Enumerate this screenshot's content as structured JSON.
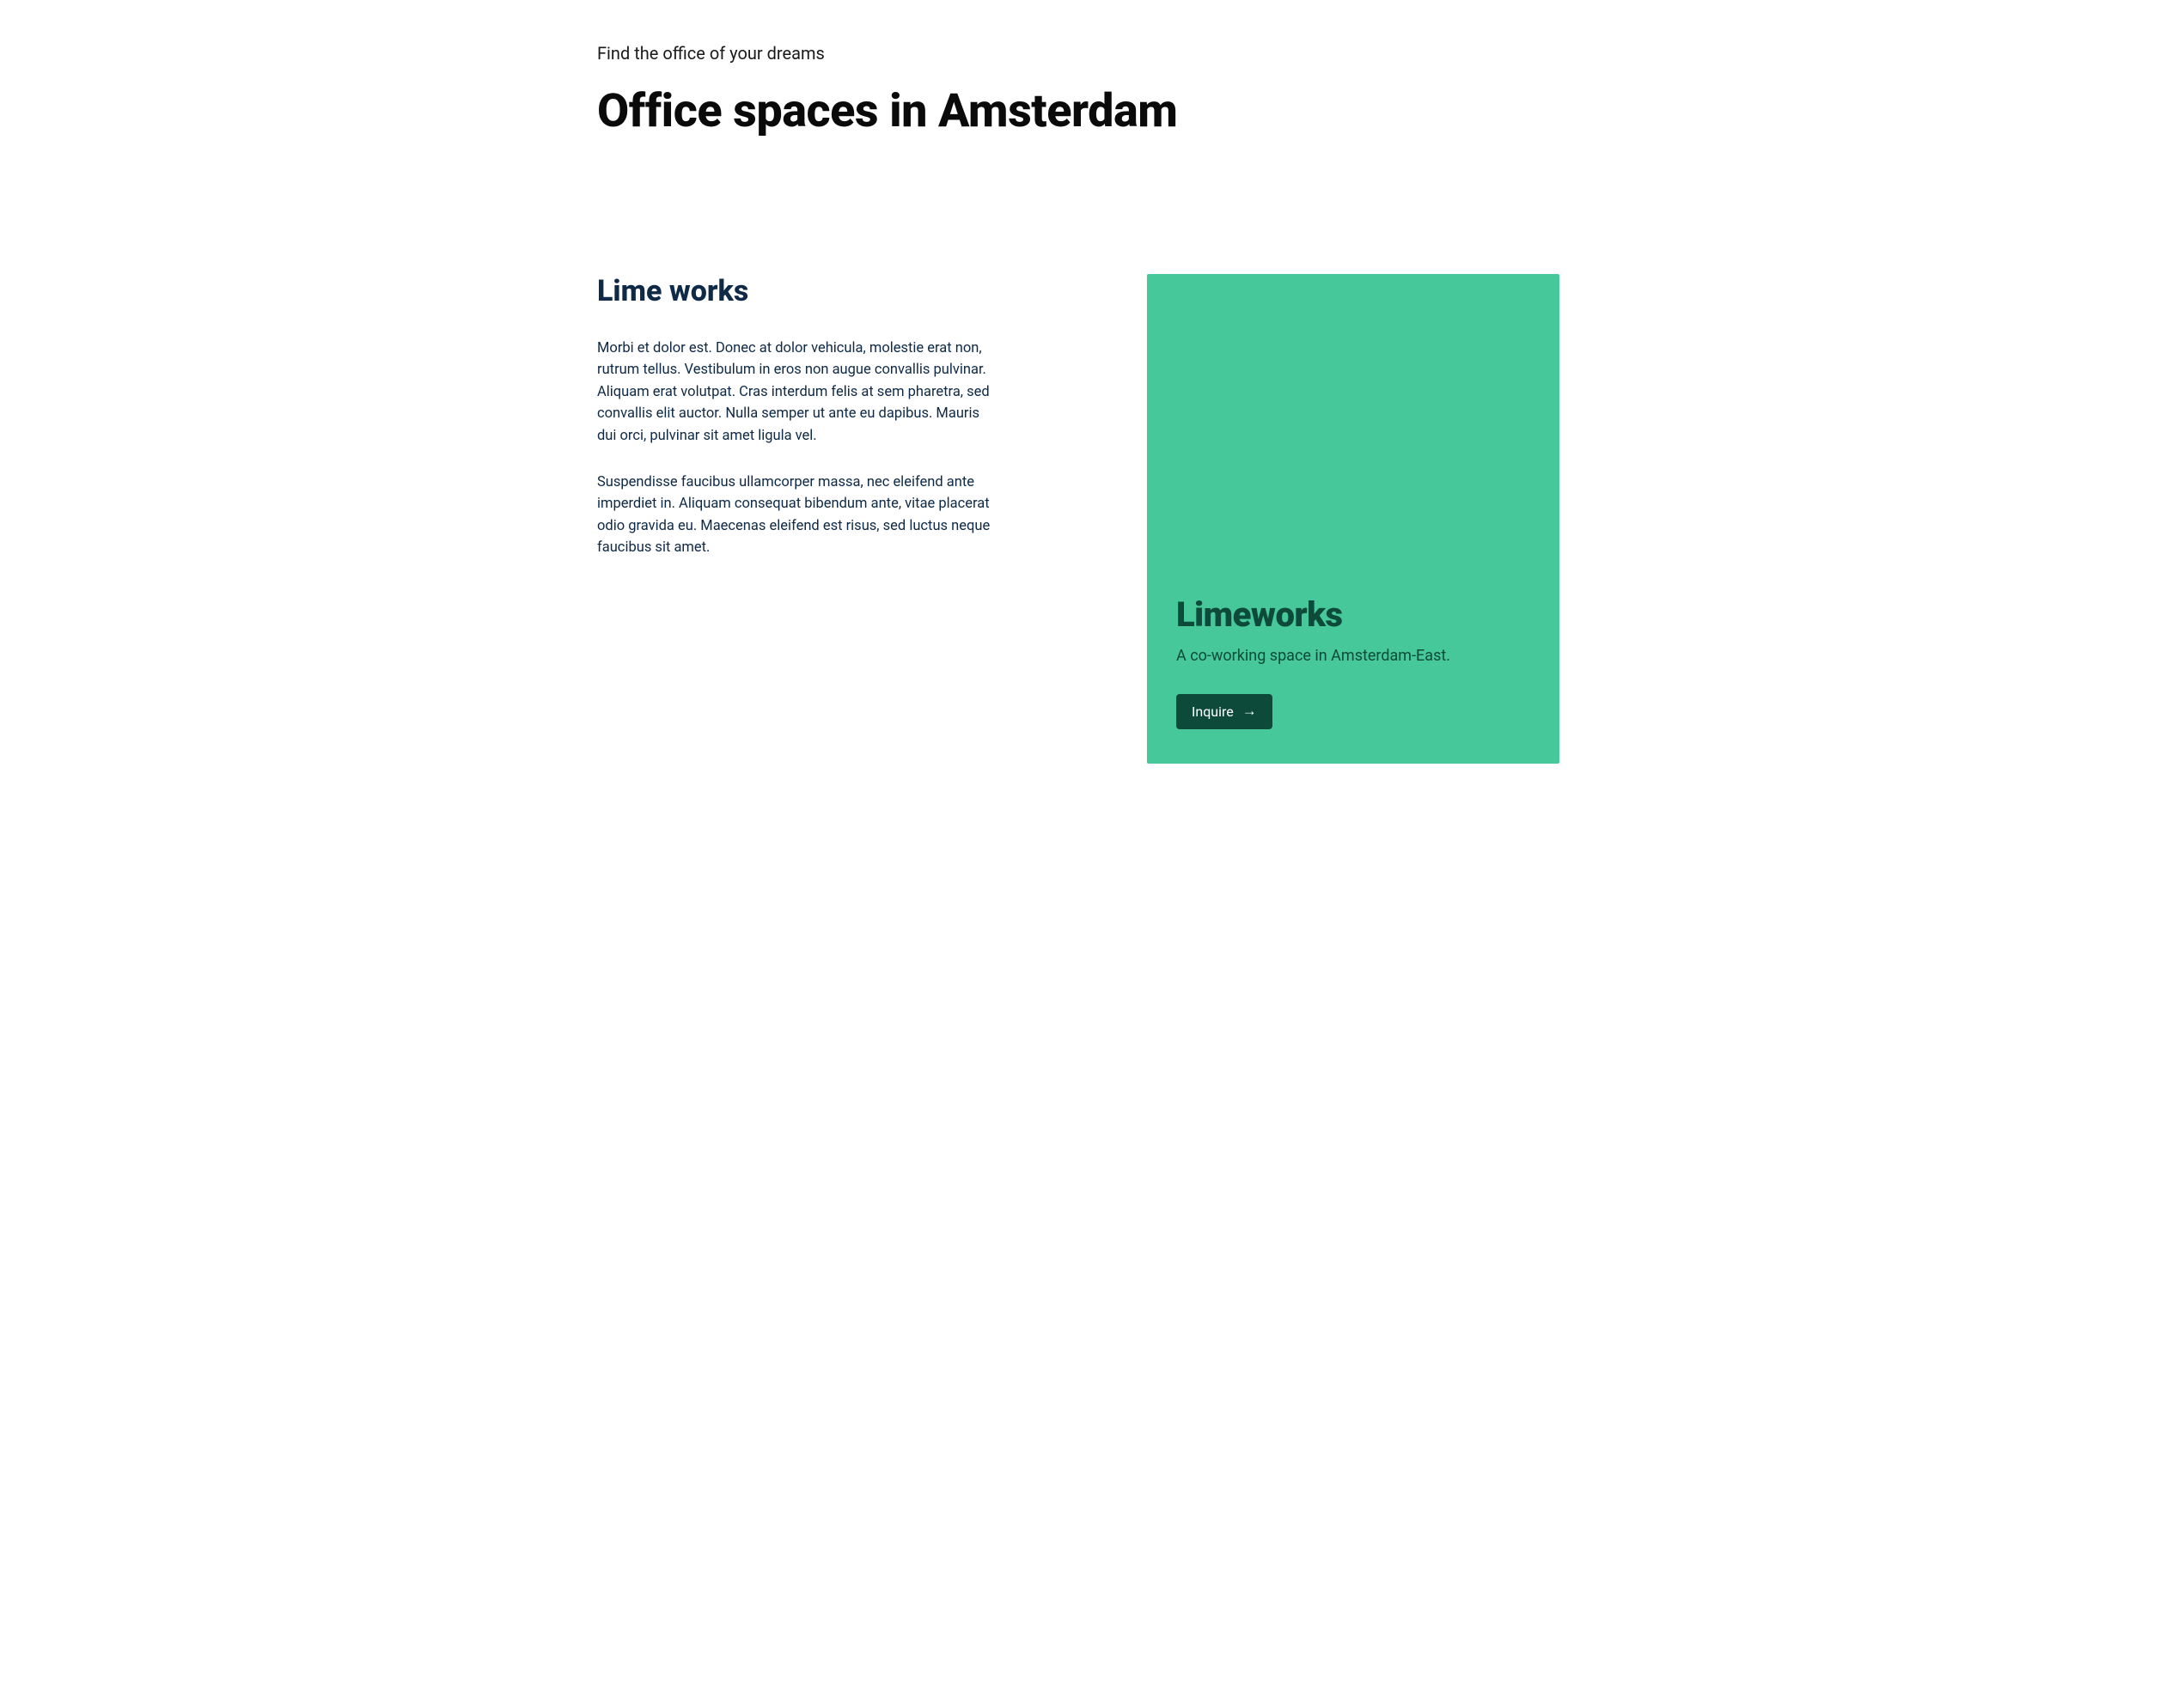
{
  "header": {
    "eyebrow": "Find the office of your dreams",
    "title": "Office spaces in Amsterdam"
  },
  "listing": {
    "heading": "Lime works",
    "paragraphs": [
      "Morbi et dolor est. Donec at dolor vehicula, molestie erat non, rutrum tellus. Vestibulum in eros non augue convallis pulvinar. Aliquam erat volutpat. Cras interdum felis at sem pharetra, sed convallis elit auctor. Nulla semper ut ante eu dapibus. Mauris dui orci, pulvinar sit amet ligula vel.",
      "Suspendisse faucibus ullamcorper massa, nec eleifend ante imperdiet in. Aliquam consequat bibendum ante, vitae placerat odio gravida eu. Maecenas eleifend est risus, sed luctus neque faucibus sit amet."
    ]
  },
  "card": {
    "title": "Limeworks",
    "subtitle": "A co-working space in Amsterdam-East.",
    "cta_label": "Inquire"
  },
  "icons": {
    "arrow_right": "→"
  },
  "colors": {
    "card_bg": "#46c89a",
    "card_text": "#0d4a3a",
    "heading_text": "#0e2a47",
    "cta_bg": "#0d4a3a"
  }
}
